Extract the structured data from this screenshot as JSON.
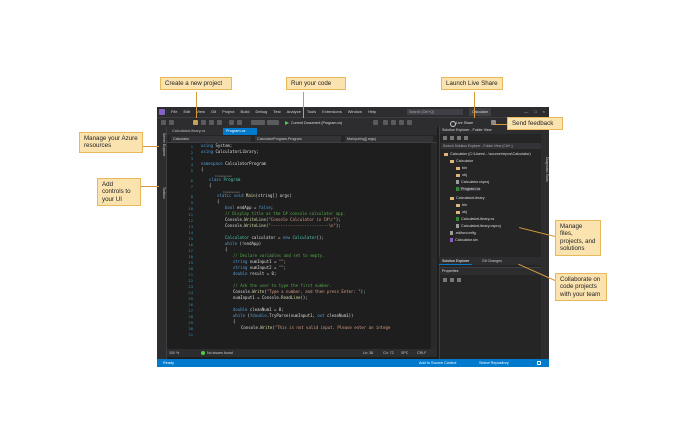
{
  "callouts": {
    "new_project": "Create a new project",
    "run_code": "Run your code",
    "live_share": "Launch Live Share",
    "feedback": "Send feedback",
    "azure": "Manage your Azure resources",
    "add_controls": "Add controls to your UI",
    "manage_files": "Manage files, projects, and solutions",
    "collaborate": "Collaborate on code projects with your team"
  },
  "menu": [
    "File",
    "Edit",
    "View",
    "Git",
    "Project",
    "Build",
    "Debug",
    "Test",
    "Analyze",
    "Tools",
    "Extensions",
    "Window",
    "Help"
  ],
  "search_box": "Search (Ctrl+Q)",
  "title_badge": "Calculator",
  "window_buttons": [
    "—",
    "□",
    "×"
  ],
  "toolbar": {
    "run_label": "Current Document (Program.cs)",
    "live_share": "Live Share"
  },
  "left_rail": [
    "Server Explorer",
    "Toolbox"
  ],
  "tabs": [
    "CalculatorLibrary.cs",
    "Program.cs"
  ],
  "nav": [
    "Calculator",
    "CalculatorProgram.Program",
    "Main(string[] args)"
  ],
  "line_numbers": [
    "1",
    "2",
    "3",
    "4",
    "5",
    "6",
    "7",
    "8",
    "9",
    "10",
    "11",
    "12",
    "13",
    "14",
    "15",
    "16",
    "17",
    "18",
    "19",
    "20",
    "21",
    "22",
    "23",
    "24",
    "25",
    "26",
    "27",
    "28",
    "29",
    "30",
    "31"
  ],
  "code": {
    "l1a": "using",
    "l1b": " System;",
    "l2a": "using",
    "l2b": " CalculatorLibrary;",
    "l4a": "namespace",
    "l4b": " CalculatorProgram",
    "l5": "{",
    "lens1": "0 references",
    "l6a": "class",
    "l6b": " Program",
    "l7": "{",
    "lens2": "0 references",
    "l8a": "static void",
    "l8b": " Main",
    "l8c": "(string[] args)",
    "l9": "{",
    "l10a": "bool",
    "l10b": " endApp = ",
    "l10c": "false",
    "l10d": ";",
    "l11": "// Display title as the C# console calculator app.",
    "l12a": "Console.",
    "l12b": "WriteLine",
    "l12c": "(",
    "l12d": "\"Console Calculator in C#\\r\"",
    "l12e": ");",
    "l13a": "Console.",
    "l13b": "WriteLine",
    "l13c": "(",
    "l13d": "\"------------------------\\n\"",
    "l13e": ");",
    "l15a": "Calculator",
    "l15b": " calculator = ",
    "l15c": "new",
    "l15d": " Calculator",
    "l15e": "();",
    "l16a": "while",
    "l16b": " (!endApp)",
    "l17": "{",
    "l18": "// Declare variables and set to empty.",
    "l19a": "string",
    "l19b": " numInput1 = ",
    "l19c": "\"\"",
    "l19d": ";",
    "l20a": "string",
    "l20b": " numInput2 = ",
    "l20c": "\"\"",
    "l20d": ";",
    "l21a": "double",
    "l21b": " result = 0;",
    "l23": "// Ask the user to type the first number.",
    "l24a": "Console.",
    "l24b": "Write",
    "l24c": "(",
    "l24d": "\"Type a number, and then press Enter: \"",
    "l24e": ");",
    "l25a": "numInput1 = Console.",
    "l25b": "ReadLine",
    "l25c": "();",
    "l27a": "double",
    "l27b": " cleanNum1 = 0;",
    "l28a": "while",
    "l28b": " (!",
    "l28c": "double",
    "l28d": ".TryParse(numInput1, ",
    "l28e": "out",
    "l28f": " cleanNum1))",
    "l29": "{",
    "l30a": "Console.",
    "l30b": "Write",
    "l30c": "(",
    "l30d": "\"This is not valid input. Please enter an intege"
  },
  "editor_status": {
    "zoom": "100 %",
    "issues": "No issues found",
    "ln": "Ln: 38",
    "ch": "Ch: 72",
    "spc": "SPC",
    "crlf": "CRLF"
  },
  "solution_explorer": {
    "title": "Solution Explorer - Folder View",
    "search": "Search Solution Explorer - Folder View (Ctrl+;)",
    "items": [
      "Calculator (C:\\Users\\...\\source\\repos\\Calculator)",
      "Calculator",
      "bin",
      "obj",
      "Calculator.csproj",
      "Program.cs",
      "CalculatorLibrary",
      "bin",
      "obj",
      "CalculatorLibrary.cs",
      "CalculatorLibrary.csproj",
      ".editorconfig",
      "Calculator.sln"
    ],
    "tabs": [
      "Solution Explorer",
      "Git Changes"
    ]
  },
  "properties_title": "Properties",
  "right_rail": [
    "Diagnostic Tools"
  ],
  "statusbar": {
    "ready": "Ready",
    "source_control": "Add to Source Control",
    "repository": "Select Repository"
  }
}
